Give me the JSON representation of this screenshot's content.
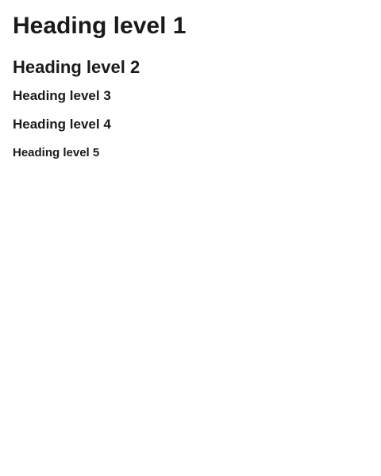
{
  "headings": {
    "h1": "Heading level 1",
    "h2": "Heading level 2",
    "h3": "Heading level 3",
    "h4": "Heading level 4",
    "h5": "Heading level 5"
  }
}
